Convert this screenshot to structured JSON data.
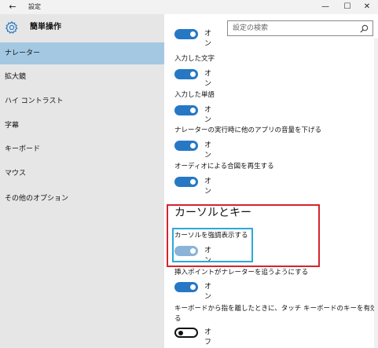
{
  "window": {
    "back_glyph": "←",
    "title": "設定",
    "minimize_glyph": "—",
    "maximize_glyph": "☐",
    "close_glyph": "✕"
  },
  "sidebar": {
    "heading": "簡単操作",
    "items": [
      {
        "label": "ナレーター",
        "selected": true
      },
      {
        "label": "拡大鏡"
      },
      {
        "label": "ハイ コントラスト"
      },
      {
        "label": "字幕"
      },
      {
        "label": "キーボード"
      },
      {
        "label": "マウス"
      },
      {
        "label": "その他のオプション"
      }
    ]
  },
  "search": {
    "placeholder": "設定の検索"
  },
  "settings": {
    "top_toggle_state": "オン",
    "typed_chars_label": "入力した文字",
    "typed_chars_state": "オン",
    "typed_words_label": "入力した単語",
    "typed_words_state": "オン",
    "lower_volume_label": "ナレーターの実行時に他のアプリの音量を下げる",
    "lower_volume_state": "オン",
    "audio_cues_label": "オーディオによる合図を再生する",
    "audio_cues_state": "オン",
    "cursor_section_title": "カーソルとキー",
    "highlight_cursor_label": "カーソルを強調表示する",
    "highlight_cursor_state": "オン",
    "insertion_point_label": "挿入ポイントがナレーターを追うようにする",
    "insertion_point_state": "オン",
    "touch_keyboard_label_line1": "キーボードから指を離したときに、タッチ キーボードのキーを有効にす",
    "touch_keyboard_label_line2": "る",
    "touch_keyboard_state": "オフ"
  },
  "colors": {
    "accent": "#2678c5",
    "selected_nav": "#a4c8e2",
    "highlight_red": "#d4252b",
    "highlight_blue": "#2ea8d8"
  }
}
